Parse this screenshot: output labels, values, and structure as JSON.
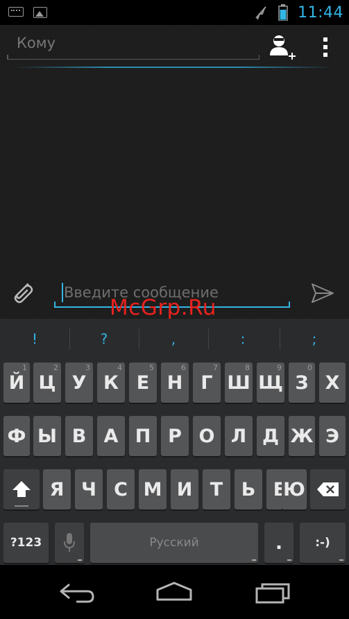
{
  "status_bar": {
    "clock": "11:44",
    "colors": {
      "accent": "#33b5e5",
      "icon": "#9a9a9a"
    }
  },
  "recipient": {
    "to_placeholder": "Кому"
  },
  "compose": {
    "message_placeholder": "Введите сообщение"
  },
  "watermark": "McGrp.Ru",
  "keyboard": {
    "suggestions": [
      "!",
      "?",
      ",",
      ":",
      ";"
    ],
    "row1": [
      {
        "label": "Й",
        "hint": "1"
      },
      {
        "label": "Ц",
        "hint": "2"
      },
      {
        "label": "У",
        "hint": "3"
      },
      {
        "label": "К",
        "hint": "4"
      },
      {
        "label": "Е",
        "hint": "5"
      },
      {
        "label": "Н",
        "hint": "6"
      },
      {
        "label": "Г",
        "hint": "7"
      },
      {
        "label": "Ш",
        "hint": "8"
      },
      {
        "label": "Щ",
        "hint": "9"
      },
      {
        "label": "З",
        "hint": "0"
      },
      {
        "label": "Х",
        "hint": ""
      }
    ],
    "row2": [
      "Ф",
      "Ы",
      "В",
      "А",
      "П",
      "Р",
      "О",
      "Л",
      "Д",
      "Ж",
      "Э"
    ],
    "row3": [
      "Я",
      "Ч",
      "С",
      "М",
      "И",
      "Т",
      "Ь",
      "Б",
      "Ю"
    ],
    "symbols_label": "?123",
    "space_label": "Русский",
    "period_label": ".",
    "smiley_label": ":-)"
  },
  "icons": {
    "status_left": [
      "keyboard-icon",
      "image-icon"
    ],
    "status_right": [
      "no-signal-icon",
      "battery-icon"
    ],
    "recipient": [
      "add-contact-icon",
      "overflow-menu-icon"
    ],
    "compose": [
      "attach-icon",
      "send-icon"
    ],
    "keyboard": [
      "shift-icon",
      "backspace-icon",
      "microphone-icon"
    ],
    "nav": [
      "back-icon",
      "home-icon",
      "recent-apps-icon"
    ]
  }
}
